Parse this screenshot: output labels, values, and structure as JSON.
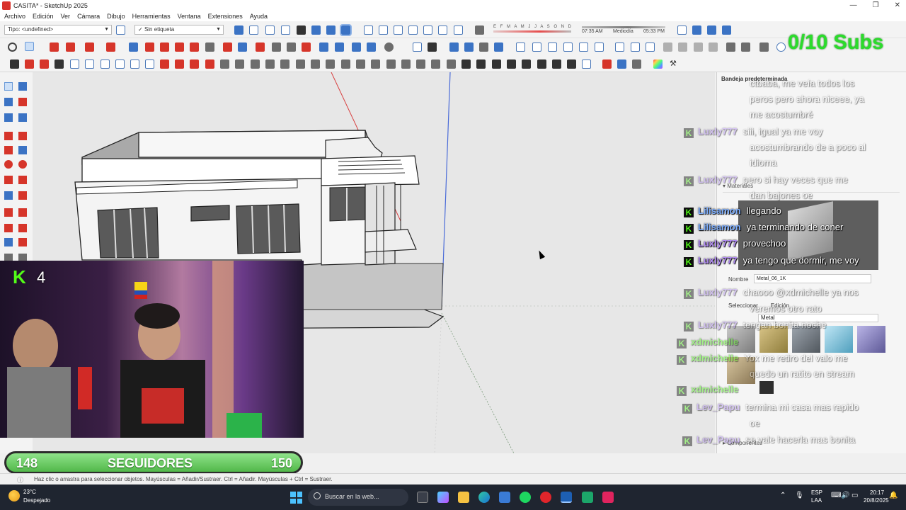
{
  "window": {
    "title": "CASITA* - SketchUp 2025",
    "controls": [
      "—",
      "❐",
      "✕"
    ]
  },
  "menu": [
    "Archivo",
    "Edición",
    "Ver",
    "Cámara",
    "Dibujo",
    "Herramientas",
    "Ventana",
    "Extensiones",
    "Ayuda"
  ],
  "toolbar": {
    "type_dropdown": "Tipo: <undefined>",
    "tag_dropdown": "Sin etiqueta",
    "months": "E F M A M J J A S O N D",
    "time_start": "07:35 AM",
    "time_mid": "Mediodía",
    "time_end": "05:33 PM"
  },
  "overlay": {
    "subs": "0/10 Subs",
    "cam_badge": "K",
    "cam_count": "4",
    "goal_current": "148",
    "goal_label": "SEGUIDORES",
    "goal_target": "150"
  },
  "tray": {
    "title": "Bandeja predeterminada",
    "materials_header": "Materiales",
    "name_label": "Nombre",
    "material_name": "Metal_06_1K",
    "tab_select": "Seleccionar",
    "tab_edit": "Edición",
    "library": "Metal",
    "components_header": "Componentes"
  },
  "chat": [
    {
      "user": "",
      "text": "ctbaba, me veía todos los",
      "faded": true
    },
    {
      "user": "",
      "text": "peros pero ahora niceee, ya",
      "faded": true
    },
    {
      "user": "",
      "text": "me acostumbré",
      "faded": true
    },
    {
      "user": "Luxly777",
      "text": "siii, igual ya me voy",
      "faded": true
    },
    {
      "user": "",
      "text": "acostumbrando de a poco al",
      "faded": true
    },
    {
      "user": "",
      "text": "idioma",
      "faded": true
    },
    {
      "user": "Luxly777",
      "text": "pero si hay veces que me",
      "faded": true
    },
    {
      "user": "",
      "text": "dan bajones oe",
      "faded": true
    },
    {
      "user": "Lilisamon",
      "text": "llegando",
      "faded": false
    },
    {
      "user": "Lilisamon",
      "text": "ya terminando de coner",
      "faded": false
    },
    {
      "user": "Luxly777",
      "text": "provechoo",
      "faded": false
    },
    {
      "user": "Luxly777",
      "text": "ya tengo que dormir, me voy",
      "faded": false
    },
    {
      "user": "Luxly777",
      "text": "chaooo @xdmichelle ya nos",
      "faded": true
    },
    {
      "user": "",
      "text": "veremos otro rato",
      "faded": true
    },
    {
      "user": "Luxly777",
      "text": "tengan bonita noche",
      "faded": true
    },
    {
      "user": "xdmichelle",
      "text": "",
      "faded": true
    },
    {
      "user": "xdmichelle",
      "text": "Yox me retiro del valo me",
      "faded": true
    },
    {
      "user": "",
      "text": "quedo un ratito en stream",
      "faded": true
    },
    {
      "user": "xdmichelle",
      "text": "",
      "faded": true
    },
    {
      "user": "Lev_Papu",
      "text": "termina mi casa mas rapido",
      "faded": true
    },
    {
      "user": "",
      "text": "oe",
      "faded": true
    },
    {
      "user": "Lev_Papu",
      "text": "se vale hacerla mas bonita",
      "faded": true
    }
  ],
  "statusbar": {
    "hint": "Haz clic o arrastra para seleccionar objetos. Mayúsculas = Añadir/Sustraer. Ctrl = Añadir. Mayúsculas + Ctrl = Sustraer."
  },
  "taskbar": {
    "weather_temp": "23°C",
    "weather_desc": "Despejado",
    "search_placeholder": "Buscar en la web...",
    "lang1": "ESP",
    "lang2": "LAA",
    "time": "20:17",
    "date": "20/8/2025"
  },
  "colors": {
    "kick_green": "#53fc18",
    "subs_green": "#2bdc2b",
    "user_purple": "#b28cf5",
    "user_blue": "#7fb0ff",
    "user_green": "#53fc18"
  }
}
